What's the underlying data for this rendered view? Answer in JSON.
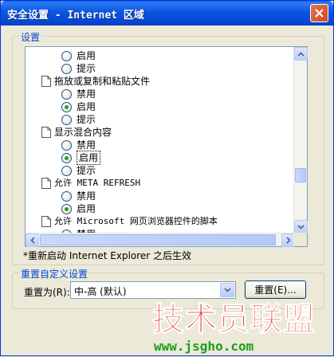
{
  "window": {
    "title": "安全设置 - Internet 区域"
  },
  "settings_group": {
    "title": "设置"
  },
  "settings_list": [
    {
      "kind": "option",
      "label": "启用",
      "checked": false
    },
    {
      "kind": "option",
      "label": "提示",
      "checked": false
    },
    {
      "kind": "header",
      "label": "拖放或复制和粘贴文件"
    },
    {
      "kind": "option",
      "label": "禁用",
      "checked": false
    },
    {
      "kind": "option",
      "label": "启用",
      "checked": true
    },
    {
      "kind": "option",
      "label": "提示",
      "checked": false
    },
    {
      "kind": "header",
      "label": "显示混合内容"
    },
    {
      "kind": "option",
      "label": "禁用",
      "checked": false
    },
    {
      "kind": "option",
      "label": "启用",
      "checked": true,
      "focused": true
    },
    {
      "kind": "option",
      "label": "提示",
      "checked": false
    },
    {
      "kind": "header",
      "label": "允许 META REFRESH"
    },
    {
      "kind": "option",
      "label": "禁用",
      "checked": false
    },
    {
      "kind": "option",
      "label": "启用",
      "checked": true
    },
    {
      "kind": "header",
      "label": "允许 Microsoft 网页浏览器控件的脚本"
    },
    {
      "kind": "option",
      "label": "禁用",
      "checked": false
    }
  ],
  "note": "*重新启动 Internet Explorer 之后生效",
  "reset_group": {
    "title": "重置自定义设置",
    "reset_to_label": "重置为(R):",
    "reset_to_value": "中-高 (默认)",
    "reset_button": "重置(E)..."
  },
  "watermark": {
    "text": "技术员联盟",
    "url": "www.jsgho.com"
  },
  "colors": {
    "titlebar": "#0a55e0",
    "group_title": "#0046d5",
    "watermark_red": "#ef1b1b",
    "watermark_green": "#1aa11a"
  }
}
